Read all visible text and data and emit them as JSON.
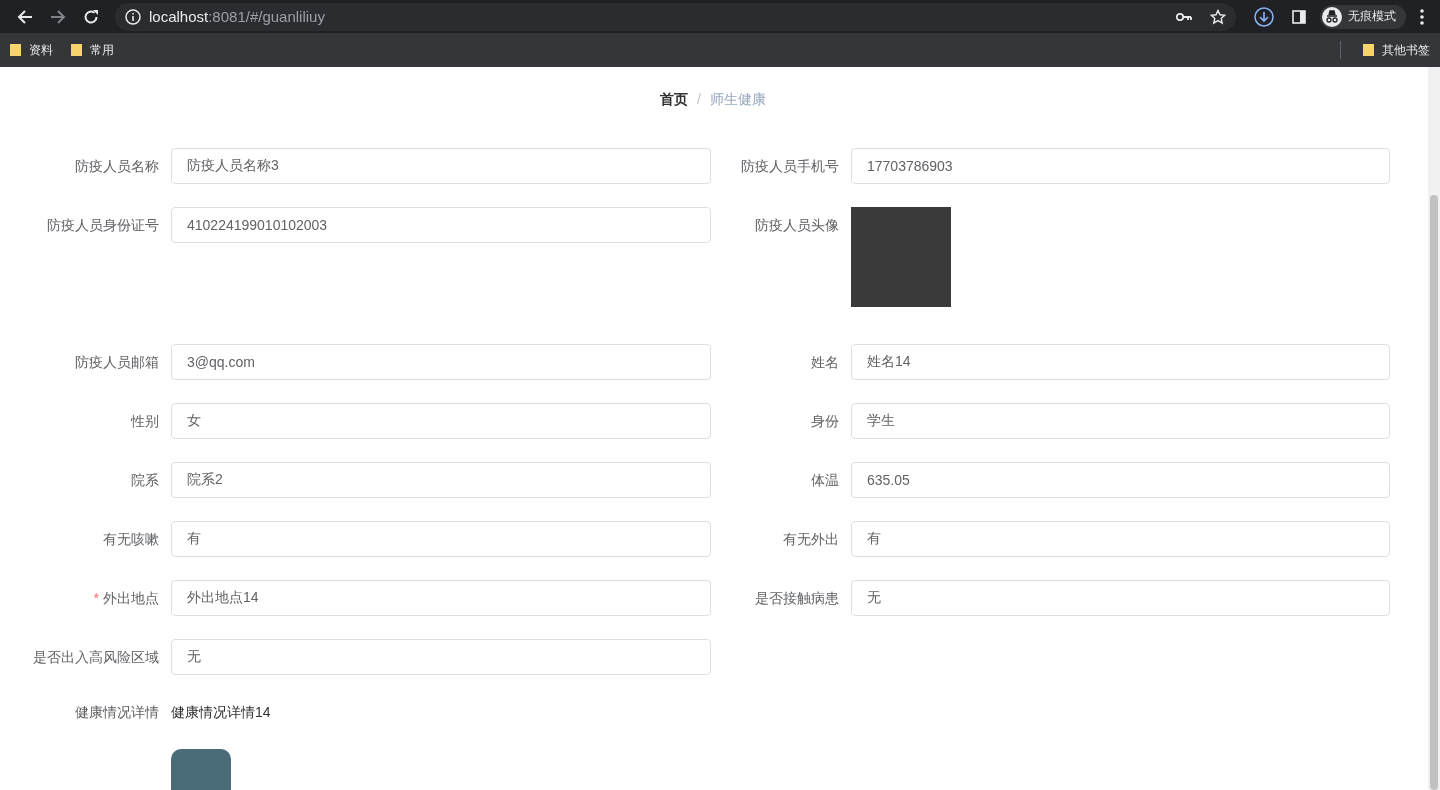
{
  "browser": {
    "url_host": "localhost",
    "url_path": ":8081/#/guanliliuy",
    "profile_label": "无痕模式",
    "bookmarks": [
      "资料",
      "常用"
    ],
    "other_bookmarks": "其他书签"
  },
  "breadcrumb_separator": "/",
  "required_mark": "*",
  "breadcrumb": [
    {
      "label": "首页",
      "current": false
    },
    {
      "label": "师生健康",
      "current": true
    }
  ],
  "fields": [
    {
      "kind": "input",
      "label": "防疫人员名称",
      "value": "防疫人员名称3",
      "required": false
    },
    {
      "kind": "input",
      "label": "防疫人员手机号",
      "value": "17703786903",
      "required": false
    },
    {
      "kind": "input",
      "label": "防疫人员身份证号",
      "value": "410224199010102003",
      "required": false
    },
    {
      "kind": "photo",
      "label": "防疫人员头像",
      "required": false
    },
    {
      "kind": "input",
      "label": "防疫人员邮箱",
      "value": "3@qq.com",
      "required": false
    },
    {
      "kind": "input",
      "label": "姓名",
      "value": "姓名14",
      "required": false
    },
    {
      "kind": "input",
      "label": "性别",
      "value": "女",
      "required": false
    },
    {
      "kind": "input",
      "label": "身份",
      "value": "学生",
      "required": false
    },
    {
      "kind": "input",
      "label": "院系",
      "value": "院系2",
      "required": false
    },
    {
      "kind": "input",
      "label": "体温",
      "value": "635.05",
      "required": false
    },
    {
      "kind": "input",
      "label": "有无咳嗽",
      "value": "有",
      "required": false
    },
    {
      "kind": "input",
      "label": "有无外出",
      "value": "有",
      "required": false
    },
    {
      "kind": "input",
      "label": "外出地点",
      "value": "外出地点14",
      "required": true
    },
    {
      "kind": "input",
      "label": "是否接触病患",
      "value": "无",
      "required": false
    },
    {
      "kind": "input",
      "label": "是否出入高风险区域",
      "value": "无",
      "required": false
    },
    {
      "kind": "text",
      "label": "健康情况详情",
      "value": "健康情况详情14",
      "required": false
    },
    {
      "kind": "image",
      "required": false
    }
  ]
}
